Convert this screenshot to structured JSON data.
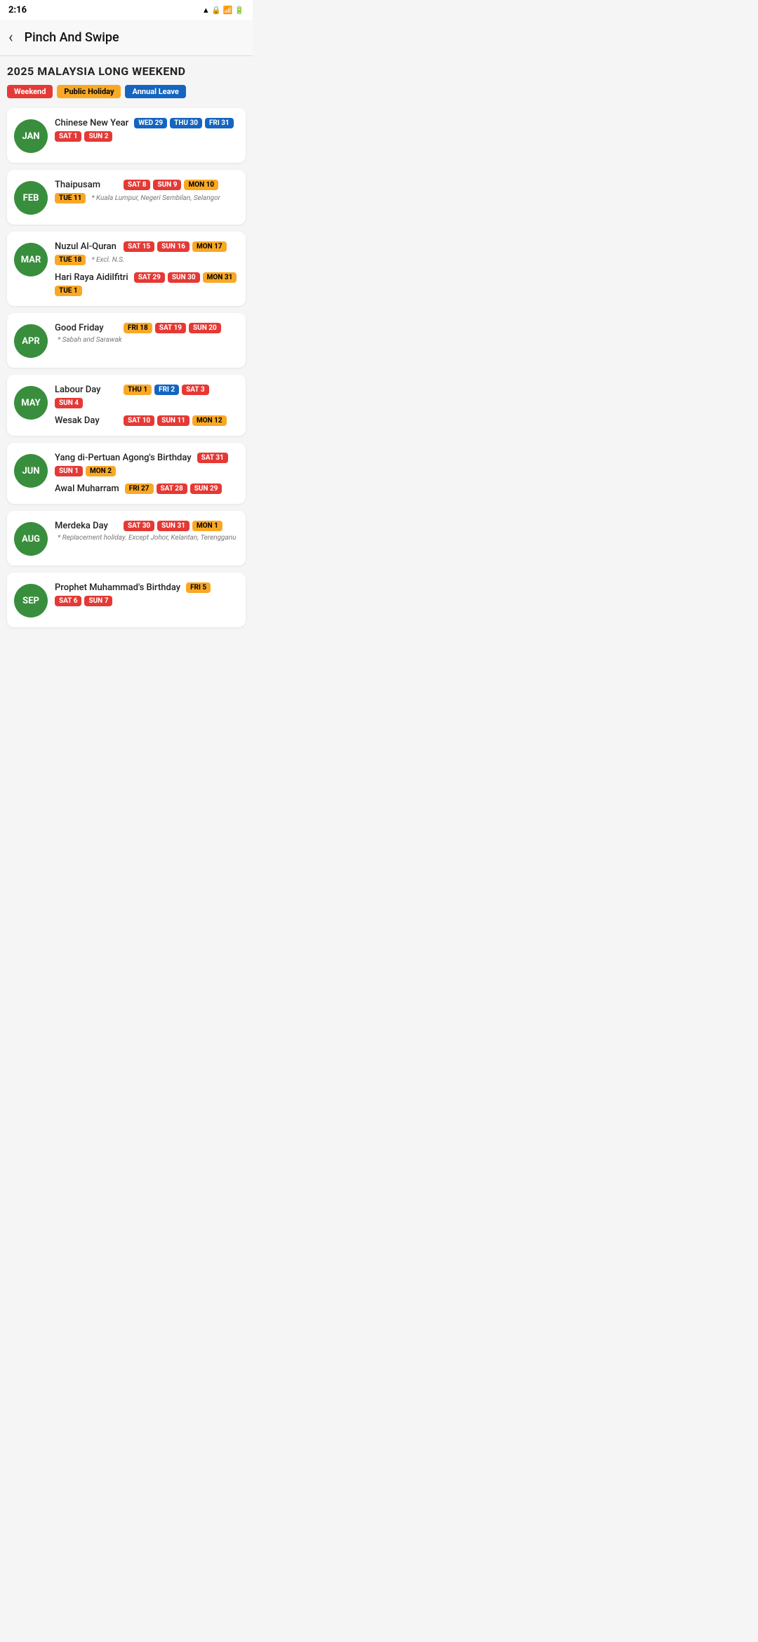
{
  "status": {
    "time": "2:16",
    "icons": "▲ 🔒 📶 🔋"
  },
  "toolbar": {
    "back_label": "‹",
    "title": "Pinch And Swipe"
  },
  "page": {
    "heading": "2025 MALAYSIA LONG WEEKEND"
  },
  "legend": [
    {
      "id": "weekend",
      "label": "Weekend",
      "class": "badge-weekend"
    },
    {
      "id": "holiday",
      "label": "Public Holiday",
      "class": "badge-holiday"
    },
    {
      "id": "annual",
      "label": "Annual Leave",
      "class": "badge-annual"
    }
  ],
  "months": [
    {
      "id": "jan",
      "label": "JAN",
      "events": [
        {
          "name": "Chinese New Year",
          "days": [
            {
              "label": "WED 29",
              "type": "blue"
            },
            {
              "label": "THU 30",
              "type": "blue"
            },
            {
              "label": "FRI 31",
              "type": "blue"
            },
            {
              "label": "SAT 1",
              "type": "red"
            },
            {
              "label": "SUN 2",
              "type": "red"
            }
          ],
          "note": ""
        }
      ]
    },
    {
      "id": "feb",
      "label": "FEB",
      "events": [
        {
          "name": "Thaipusam",
          "days": [
            {
              "label": "SAT 8",
              "type": "red"
            },
            {
              "label": "SUN 9",
              "type": "red"
            },
            {
              "label": "MON 10",
              "type": "yellow"
            },
            {
              "label": "TUE 11",
              "type": "yellow"
            }
          ],
          "note": "* Kuala Lumpur, Negeri Sembilan, Selangor"
        }
      ]
    },
    {
      "id": "mar",
      "label": "MAR",
      "events": [
        {
          "name": "Nuzul Al-Quran",
          "days": [
            {
              "label": "SAT 15",
              "type": "red"
            },
            {
              "label": "SUN 16",
              "type": "red"
            },
            {
              "label": "MON 17",
              "type": "yellow"
            },
            {
              "label": "TUE 18",
              "type": "yellow"
            }
          ],
          "note": "* Excl. N.S."
        },
        {
          "name": "Hari Raya Aidilfitri",
          "days": [
            {
              "label": "SAT 29",
              "type": "red"
            },
            {
              "label": "SUN 30",
              "type": "red"
            },
            {
              "label": "MON 31",
              "type": "yellow"
            },
            {
              "label": "TUE 1",
              "type": "yellow"
            }
          ],
          "note": ""
        }
      ]
    },
    {
      "id": "apr",
      "label": "APR",
      "events": [
        {
          "name": "Good Friday",
          "days": [
            {
              "label": "FRI 18",
              "type": "yellow"
            },
            {
              "label": "SAT 19",
              "type": "red"
            },
            {
              "label": "SUN 20",
              "type": "red"
            }
          ],
          "note": "* Sabah and Sarawak"
        }
      ]
    },
    {
      "id": "may",
      "label": "MAY",
      "events": [
        {
          "name": "Labour Day",
          "days": [
            {
              "label": "THU 1",
              "type": "yellow"
            },
            {
              "label": "FRI 2",
              "type": "blue"
            },
            {
              "label": "SAT 3",
              "type": "red"
            },
            {
              "label": "SUN 4",
              "type": "red"
            }
          ],
          "note": ""
        },
        {
          "name": "Wesak Day",
          "days": [
            {
              "label": "SAT 10",
              "type": "red"
            },
            {
              "label": "SUN 11",
              "type": "red"
            },
            {
              "label": "MON 12",
              "type": "yellow"
            }
          ],
          "note": ""
        }
      ]
    },
    {
      "id": "jun",
      "label": "JUN",
      "events": [
        {
          "name": "Yang di-Pertuan Agong's Birthday",
          "days": [
            {
              "label": "SAT 31",
              "type": "red"
            },
            {
              "label": "SUN 1",
              "type": "red"
            },
            {
              "label": "MON 2",
              "type": "yellow"
            }
          ],
          "note": ""
        },
        {
          "name": "Awal Muharram",
          "days": [
            {
              "label": "FRI 27",
              "type": "yellow"
            },
            {
              "label": "SAT 28",
              "type": "red"
            },
            {
              "label": "SUN 29",
              "type": "red"
            }
          ],
          "note": ""
        }
      ]
    },
    {
      "id": "aug",
      "label": "AUG",
      "events": [
        {
          "name": "Merdeka Day",
          "days": [
            {
              "label": "SAT 30",
              "type": "red"
            },
            {
              "label": "SUN 31",
              "type": "red"
            },
            {
              "label": "MON 1",
              "type": "yellow"
            }
          ],
          "note": "* Replacement holiday. Except Johor, Kelantan, Terengganu"
        }
      ]
    },
    {
      "id": "sep",
      "label": "SEP",
      "events": [
        {
          "name": "Prophet Muhammad's Birthday",
          "days": [
            {
              "label": "FRI 5",
              "type": "yellow"
            },
            {
              "label": "SAT 6",
              "type": "red"
            },
            {
              "label": "SUN 7",
              "type": "red"
            }
          ],
          "note": ""
        }
      ]
    }
  ]
}
